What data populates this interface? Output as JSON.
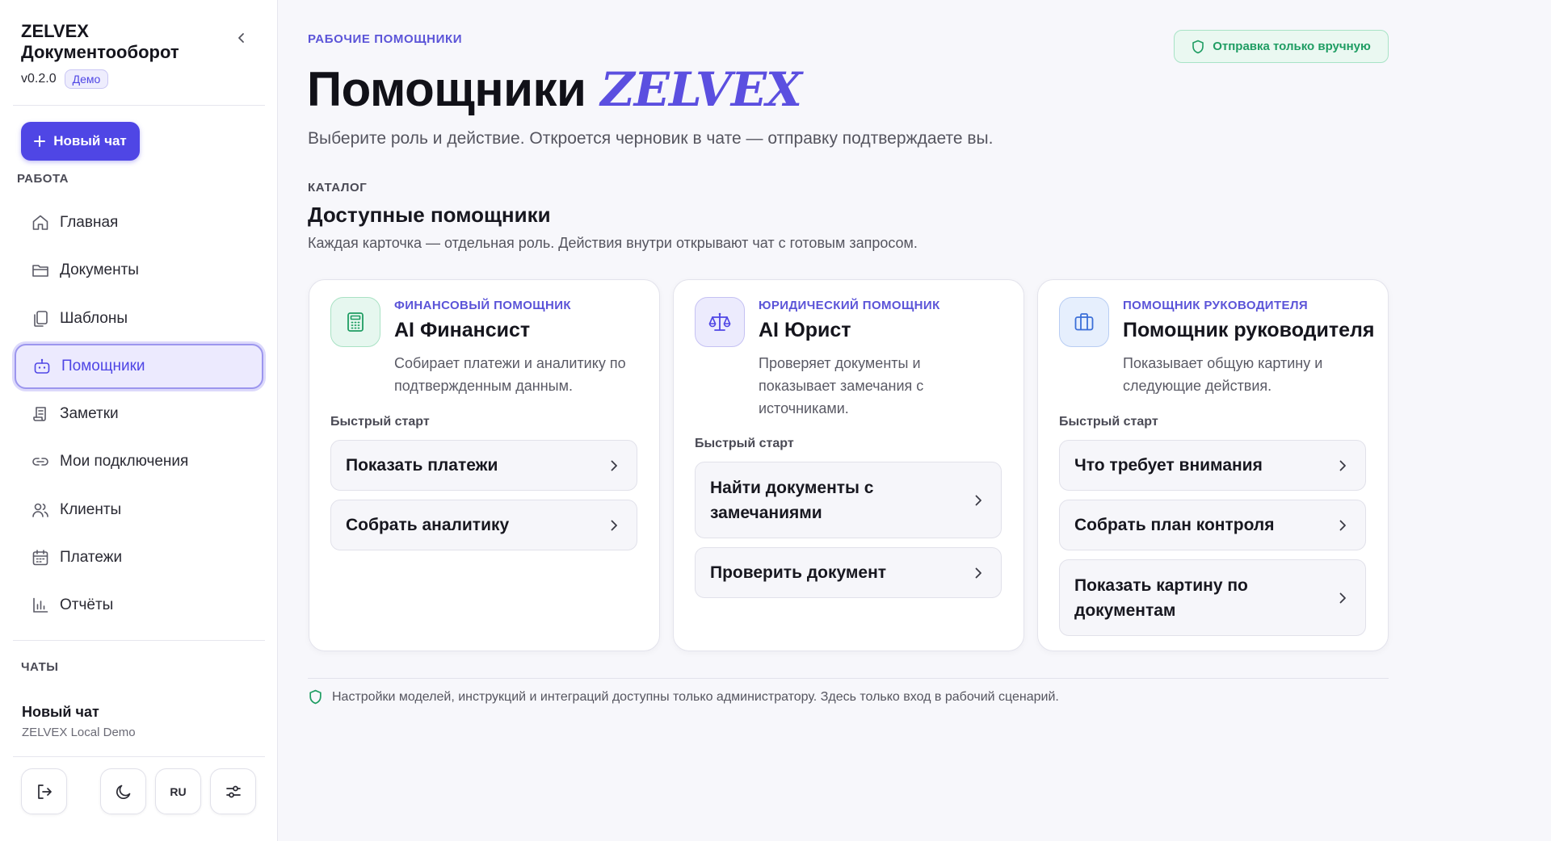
{
  "sidebar": {
    "brand_line1": "ZELVEX",
    "brand_line2": "Документооборот",
    "version": "v0.2.0",
    "demo_badge": "Демо",
    "new_chat_label": "Новый чат",
    "work_section": "РАБОТА",
    "nav": [
      {
        "label": "Главная",
        "icon": "home-icon"
      },
      {
        "label": "Документы",
        "icon": "folder-icon"
      },
      {
        "label": "Шаблоны",
        "icon": "copy-icon"
      },
      {
        "label": "Помощники",
        "icon": "bot-icon",
        "active": true
      },
      {
        "label": "Заметки",
        "icon": "scroll-icon"
      },
      {
        "label": "Мои подключения",
        "icon": "link-icon"
      },
      {
        "label": "Клиенты",
        "icon": "users-icon"
      },
      {
        "label": "Платежи",
        "icon": "calendar-icon"
      },
      {
        "label": "Отчёты",
        "icon": "bar-chart-icon"
      }
    ],
    "chats_section": "ЧАТЫ",
    "chat": {
      "title": "Новый чат",
      "subtitle": "ZELVEX Local Demo"
    },
    "lang_button": "RU"
  },
  "main": {
    "eyebrow": "РАБОЧИЕ ПОМОЩНИКИ",
    "manual_badge": "Отправка только вручную",
    "title": "Помощники",
    "title_brand": "ZELVEX",
    "lead": "Выберите роль и действие. Откроется черновик в чате — отправку подтверждаете вы.",
    "catalog_label": "КАТАЛОГ",
    "catalog_title": "Доступные помощники",
    "catalog_desc": "Каждая карточка — отдельная роль. Действия внутри открывают чат с готовым запросом.",
    "cards": [
      {
        "kicker": "ФИНАНСОВЫЙ ПОМОЩНИК",
        "name": "AI Финансист",
        "desc": "Собирает платежи и аналитику по подтвержденным данным.",
        "quick_start": "Быстрый старт",
        "icon": "calculator-icon",
        "actions": [
          "Показать платежи",
          "Собрать аналитику"
        ]
      },
      {
        "kicker": "ЮРИДИЧЕСКИЙ ПОМОЩНИК",
        "name": "AI Юрист",
        "desc": "Проверяет документы и показывает замечания с источниками.",
        "quick_start": "Быстрый старт",
        "icon": "scales-icon",
        "actions": [
          "Найти документы с замечаниями",
          "Проверить документ"
        ]
      },
      {
        "kicker": "ПОМОЩНИК РУКОВОДИТЕЛЯ",
        "name": "Помощник руководителя",
        "desc": "Показывает общую картину и следующие действия.",
        "quick_start": "Быстрый старт",
        "icon": "briefcase-icon",
        "actions": [
          "Что требует внимания",
          "Собрать план контроля",
          "Показать картину по документам"
        ]
      }
    ],
    "footer_note": "Настройки моделей, инструкций и интеграций доступны только администратору. Здесь только вход в рабочий сценарий."
  },
  "colors": {
    "accent": "#4f46e5",
    "accent_soft": "#eceafe",
    "success": "#1f9d63",
    "success_soft": "#eaf8f1"
  }
}
